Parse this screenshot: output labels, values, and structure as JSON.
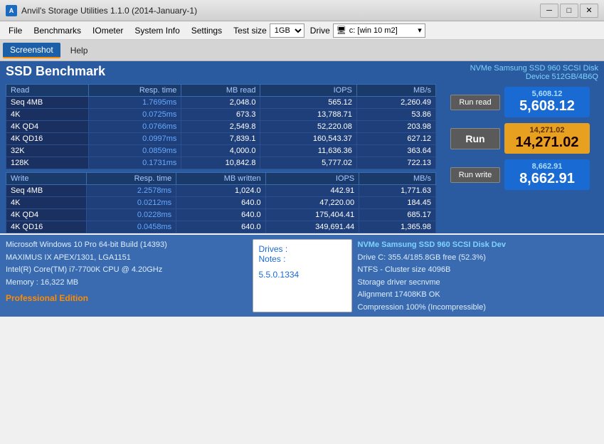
{
  "titleBar": {
    "icon": "A",
    "title": "Anvil's Storage Utilities 1.1.0 (2014-January-1)",
    "minimize": "─",
    "maximize": "□",
    "close": "✕"
  },
  "menuBar": {
    "items": [
      "File",
      "Benchmarks",
      "IOmeter",
      "System Info",
      "Settings"
    ],
    "testSizeLabel": "Test size",
    "testSizeValue": "1GB",
    "driveLabel": "Drive",
    "driveValue": "c: [win 10 m2]"
  },
  "toolbar": {
    "screenshotLabel": "Screenshot",
    "helpLabel": "Help"
  },
  "header": {
    "title": "SSD Benchmark",
    "deviceLine1": "NVMe Samsung SSD 960 SCSI Disk",
    "deviceLine2": "Device 512GB/4B6Q"
  },
  "readTable": {
    "headers": [
      "Read",
      "Resp. time",
      "MB read",
      "IOPS",
      "MB/s"
    ],
    "rows": [
      [
        "Seq 4MB",
        "1.7695ms",
        "2,048.0",
        "565.12",
        "2,260.49"
      ],
      [
        "4K",
        "0.0725ms",
        "673.3",
        "13,788.71",
        "53.86"
      ],
      [
        "4K QD4",
        "0.0766ms",
        "2,549.8",
        "52,220.08",
        "203.98"
      ],
      [
        "4K QD16",
        "0.0997ms",
        "7,839.1",
        "160,543.37",
        "627.12"
      ],
      [
        "32K",
        "0.0859ms",
        "4,000.0",
        "11,636.36",
        "363.64"
      ],
      [
        "128K",
        "0.1731ms",
        "10,842.8",
        "5,777.02",
        "722.13"
      ]
    ]
  },
  "writeTable": {
    "headers": [
      "Write",
      "Resp. time",
      "MB written",
      "IOPS",
      "MB/s"
    ],
    "rows": [
      [
        "Seq 4MB",
        "2.2578ms",
        "1,024.0",
        "442.91",
        "1,771.63"
      ],
      [
        "4K",
        "0.0212ms",
        "640.0",
        "47,220.00",
        "184.45"
      ],
      [
        "4K QD4",
        "0.0228ms",
        "640.0",
        "175,404.41",
        "685.17"
      ],
      [
        "4K QD16",
        "0.0458ms",
        "640.0",
        "349,691.44",
        "1,365.98"
      ]
    ]
  },
  "controls": {
    "runReadLabel": "Run read",
    "runLabel": "Run",
    "runWriteLabel": "Run write",
    "readScore": "5,608.12",
    "readScoreSmall": "5,608.12",
    "totalScore": "14,271.02",
    "totalScoreSmall": "14,271.02",
    "writeScore": "8,662.91",
    "writeScoreSmall": "8,662.91"
  },
  "bottomLeft": {
    "line1": "Microsoft Windows 10 Pro 64-bit Build (14393)",
    "line2": "MAXIMUS IX APEX/1301, LGA1151",
    "line3": "Intel(R) Core(TM) i7-7700K CPU @ 4.20GHz",
    "line4": "Memory : 16,322 MB",
    "pro": "Professional Edition"
  },
  "notes": {
    "drives": "Drives :",
    "notes": "Notes :",
    "value": "5.5.0.1334"
  },
  "bottomRight": {
    "title": "NVMe Samsung SSD 960 SCSI Disk Dev",
    "line1": "Drive C: 355.4/185.8GB free (52.3%)",
    "line2": "NTFS - Cluster size 4096B",
    "line3": "Storage driver  secnvme",
    "line4": "Alignment 17408KB OK",
    "line5": "Compression 100% (Incompressible)"
  }
}
